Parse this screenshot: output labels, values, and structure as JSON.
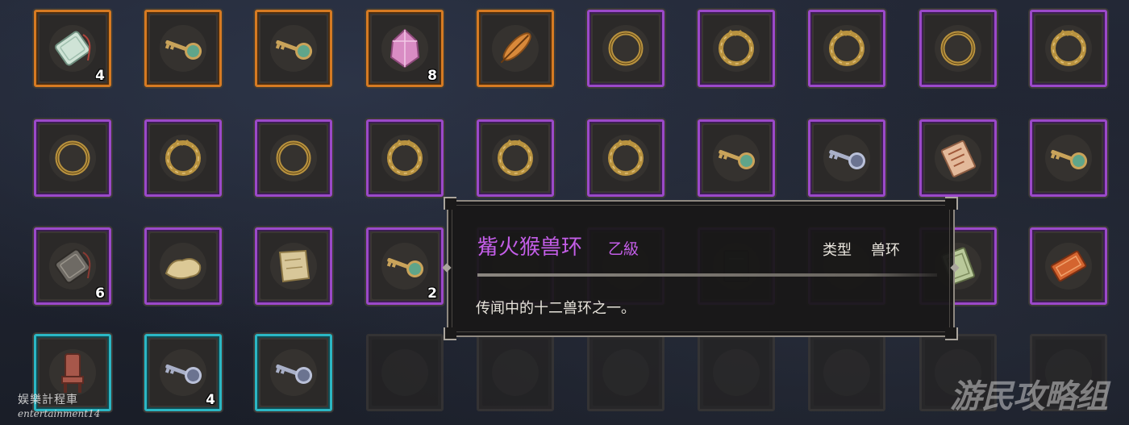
{
  "inventory": {
    "slots": [
      {
        "rarity": "orange",
        "icon": "jade-pendant-icon",
        "count": "4"
      },
      {
        "rarity": "orange",
        "icon": "key-icon",
        "count": ""
      },
      {
        "rarity": "orange",
        "icon": "key-icon",
        "count": ""
      },
      {
        "rarity": "orange",
        "icon": "pink-crystal-icon",
        "count": "8"
      },
      {
        "rarity": "orange",
        "icon": "feather-icon",
        "count": ""
      },
      {
        "rarity": "purple",
        "icon": "bronze-ring-icon",
        "count": ""
      },
      {
        "rarity": "purple",
        "icon": "beast-ring-icon",
        "count": ""
      },
      {
        "rarity": "purple",
        "icon": "beast-ring-icon",
        "count": ""
      },
      {
        "rarity": "purple",
        "icon": "bronze-ring-icon",
        "count": ""
      },
      {
        "rarity": "purple",
        "icon": "beast-ring-icon",
        "count": ""
      },
      {
        "rarity": "purple",
        "icon": "bronze-ring-icon",
        "count": ""
      },
      {
        "rarity": "purple",
        "icon": "beast-ring-icon",
        "count": ""
      },
      {
        "rarity": "purple",
        "icon": "bronze-ring-icon",
        "count": ""
      },
      {
        "rarity": "purple",
        "icon": "beast-ring-icon",
        "count": ""
      },
      {
        "rarity": "purple",
        "icon": "beast-ring-icon",
        "count": ""
      },
      {
        "rarity": "purple",
        "icon": "beast-ring-icon",
        "count": ""
      },
      {
        "rarity": "purple",
        "icon": "key-icon",
        "count": ""
      },
      {
        "rarity": "purple",
        "icon": "silver-key-icon",
        "count": ""
      },
      {
        "rarity": "purple",
        "icon": "paper-charm-icon",
        "count": ""
      },
      {
        "rarity": "purple",
        "icon": "key-icon",
        "count": ""
      },
      {
        "rarity": "purple",
        "icon": "stone-tablet-icon",
        "count": "6"
      },
      {
        "rarity": "purple",
        "icon": "cloth-bundle-icon",
        "count": ""
      },
      {
        "rarity": "purple",
        "icon": "map-scroll-icon",
        "count": ""
      },
      {
        "rarity": "purple",
        "icon": "key-icon",
        "count": "2"
      },
      {
        "rarity": "purple",
        "icon": "",
        "count": ""
      },
      {
        "rarity": "purple",
        "icon": "",
        "count": ""
      },
      {
        "rarity": "purple",
        "icon": "dark-book-icon",
        "count": ""
      },
      {
        "rarity": "purple",
        "icon": "",
        "count": ""
      },
      {
        "rarity": "purple",
        "icon": "green-book-icon",
        "count": ""
      },
      {
        "rarity": "purple",
        "icon": "red-talisman-icon",
        "count": ""
      },
      {
        "rarity": "cyan",
        "icon": "chair-icon",
        "count": ""
      },
      {
        "rarity": "cyan",
        "icon": "silver-key-icon",
        "count": "4"
      },
      {
        "rarity": "cyan",
        "icon": "silver-key-icon",
        "count": ""
      },
      {
        "rarity": "empty",
        "icon": "",
        "count": ""
      },
      {
        "rarity": "empty",
        "icon": "",
        "count": ""
      },
      {
        "rarity": "empty",
        "icon": "",
        "count": ""
      },
      {
        "rarity": "empty",
        "icon": "",
        "count": ""
      },
      {
        "rarity": "empty",
        "icon": "",
        "count": ""
      },
      {
        "rarity": "empty",
        "icon": "",
        "count": ""
      },
      {
        "rarity": "empty",
        "icon": "",
        "count": ""
      }
    ]
  },
  "tooltip": {
    "name": "觜火猴兽环",
    "grade": "乙級",
    "type_label": "类型",
    "type_value": "兽环",
    "description": "传闻中的十二兽环之一。"
  },
  "watermarks": {
    "left_line1": "娱樂計程車",
    "left_line2": "entertainment14",
    "right": "游民攻略组"
  },
  "colors": {
    "orange_border": "#d67a22",
    "purple_border": "#9b49c9",
    "cyan_border": "#2bb7c4",
    "item_name": "#c45ee8"
  }
}
